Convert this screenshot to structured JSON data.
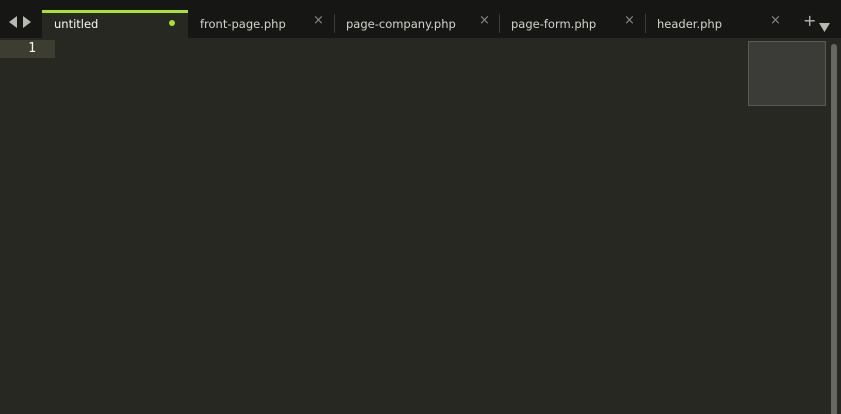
{
  "tabs": [
    {
      "label": "untitled",
      "active": true,
      "dirty": true
    },
    {
      "label": "front-page.php",
      "active": false,
      "dirty": false
    },
    {
      "label": "page-company.php",
      "active": false,
      "dirty": false
    },
    {
      "label": "page-form.php",
      "active": false,
      "dirty": false
    },
    {
      "label": "header.php",
      "active": false,
      "dirty": false
    }
  ],
  "icons": {
    "nav_left": "triangle-left-icon",
    "nav_right": "triangle-right-icon",
    "close": "close-icon",
    "dirty": "dirty-dot-icon",
    "new_tab": "plus-icon",
    "tab_list": "dropdown-icon"
  },
  "glyphs": {
    "close": "×",
    "plus": "+"
  },
  "editor": {
    "line_numbers": [
      "1"
    ]
  },
  "colors": {
    "background": "#272822",
    "tabbar": "#161614",
    "accent": "#a6e22e",
    "current_line": "#3e3d32"
  }
}
